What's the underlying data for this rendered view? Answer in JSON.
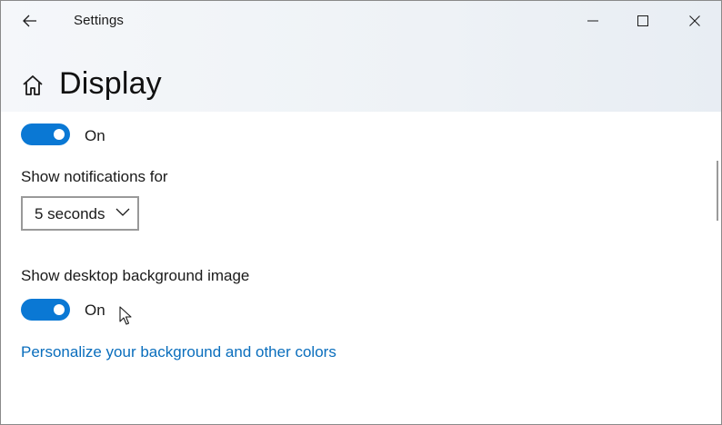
{
  "window": {
    "app_title": "Settings",
    "icons": {
      "back": "back-arrow-icon",
      "minimize": "minimize-icon",
      "maximize": "maximize-icon",
      "close": "close-icon"
    }
  },
  "header": {
    "title": "Display",
    "icon": "home-icon"
  },
  "settings": {
    "first_toggle": {
      "state_label": "On",
      "is_on": true
    },
    "notifications": {
      "label": "Show notifications for",
      "selected_value": "5 seconds",
      "icon": "chevron-down-icon"
    },
    "desktop_background": {
      "label": "Show desktop background image",
      "state_label": "On",
      "is_on": true
    },
    "personalize_link": {
      "text": "Personalize your background and other colors"
    }
  },
  "colors": {
    "accent": "#0a78d4",
    "link": "#0a6ebd",
    "header_bg": "#eef2f6"
  }
}
